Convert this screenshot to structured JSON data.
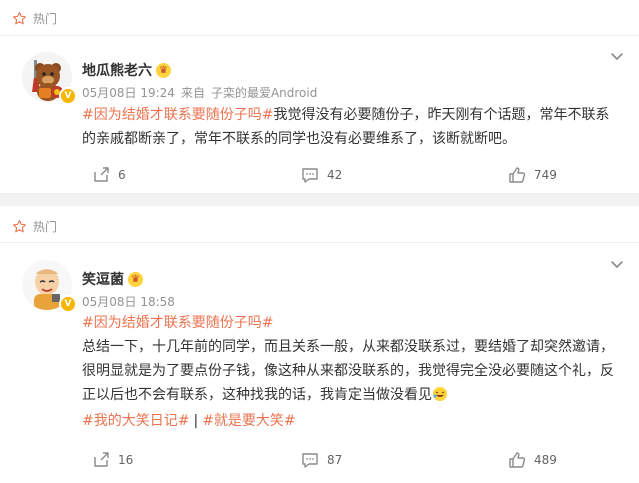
{
  "posts": [
    {
      "section_label": "热门",
      "username": "地瓜熊老六",
      "badge": "V",
      "date": "05月08日 19:24",
      "source_prefix": "来自",
      "source": "子栾的最爱Android",
      "hashtag": "#因为结婚才联系要随份子吗#",
      "text": "我觉得没有必要随份子，昨天刚有个话题，常年不联系的亲戚都断亲了，常年不联系的同学也没有必要维系了，该断就断吧。",
      "reposts": "6",
      "comments": "42",
      "likes": "749"
    },
    {
      "section_label": "热门",
      "username": "笑逗菌",
      "badge": "V",
      "date": "05月08日 18:58",
      "hashtag": "#因为结婚才联系要随份子吗#",
      "text": "总结一下，十几年前的同学，而且关系一般，从来都没联系过，要结婚了却突然邀请，很明显就是为了要点份子钱，像这种从来都没联系的，我觉得完全没必要随这个礼，反正以后也不会有联系，这种找我的话，我肯定当做没看见",
      "tag1": "#我的大笑日记#",
      "separator": "|",
      "tag2": "#就是要大笑#",
      "reposts": "16",
      "comments": "87",
      "likes": "489"
    }
  ],
  "colors": {
    "accent": "#eb7350",
    "page_bg": "#f2f2f2",
    "muted": "#939393",
    "badge": "#f7b500"
  },
  "icons": {
    "section": "star-outline-icon",
    "menu": "chevron-down-icon",
    "repost": "repost-icon",
    "comment": "comment-icon",
    "like": "thumbs-up-icon",
    "laugh": "laughing-emoji-icon"
  }
}
